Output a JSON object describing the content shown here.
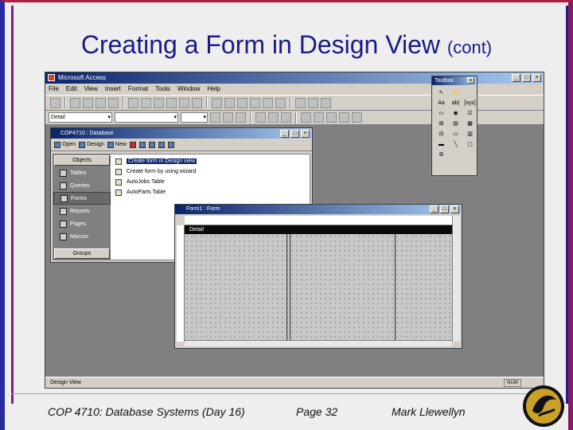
{
  "slide": {
    "title": "Creating a Form in Design View",
    "title_suffix": "(cont)"
  },
  "access": {
    "window_title": "Microsoft Access",
    "menu": [
      "File",
      "Edit",
      "View",
      "Insert",
      "Format",
      "Tools",
      "Window",
      "Help"
    ],
    "format_combo": "Detail",
    "status": "Design View",
    "status_num": "NUM"
  },
  "database_window": {
    "title": "COP4710 : Database",
    "toolbar": {
      "open": "Open",
      "design": "Design",
      "new": "New"
    },
    "objects_header": "Objects",
    "objects": [
      "Tables",
      "Queries",
      "Forms",
      "Reports",
      "Pages",
      "Macros"
    ],
    "groups": "Groups",
    "items": [
      "Create form in Design view",
      "Create form by using wizard",
      "AutoJobs Table",
      "AutoParts Table"
    ]
  },
  "toolbox": {
    "title": "Toolbox",
    "tools": [
      "↖",
      "⚡",
      "Aa",
      "ab|",
      "[xyz]",
      "▭",
      "◉",
      "☑",
      "⊞",
      "▤",
      "▦",
      "⊟",
      "▭",
      "▥",
      "▬",
      "╲",
      "▢",
      "⚙"
    ]
  },
  "form_window": {
    "title": "Form1 : Form",
    "section": "Detail"
  },
  "footer": {
    "course": "COP 4710: Database Systems (Day 16)",
    "page": "Page 32",
    "author": "Mark Llewellyn"
  },
  "colors": {
    "title_text": "#1a1a8a",
    "titlebar_start": "#0a246a",
    "titlebar_end": "#a6caf0"
  }
}
